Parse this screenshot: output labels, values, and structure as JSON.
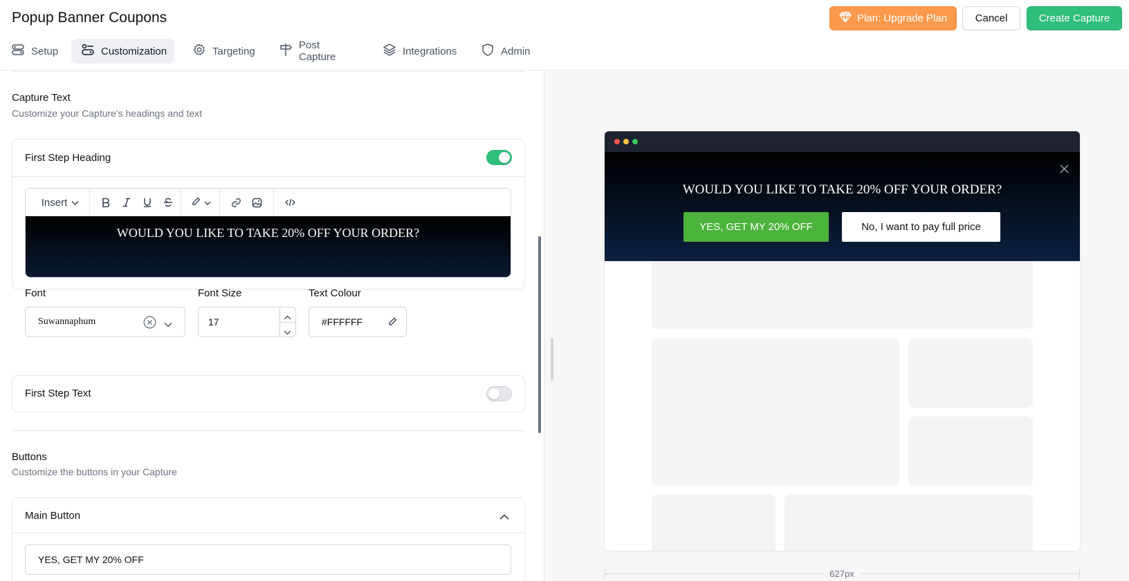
{
  "header": {
    "title": "Popup Banner Coupons",
    "upgrade_label": "Plan: Upgrade Plan",
    "cancel_label": "Cancel",
    "create_label": "Create Capture"
  },
  "tabs": [
    {
      "label": "Setup",
      "icon": "setup-icon"
    },
    {
      "label": "Customization",
      "icon": "customization-icon",
      "active": true
    },
    {
      "label": "Targeting",
      "icon": "gear-icon"
    },
    {
      "label": "Post Capture",
      "icon": "signpost-icon"
    },
    {
      "label": "Integrations",
      "icon": "layers-icon"
    },
    {
      "label": "Admin",
      "icon": "shield-icon"
    }
  ],
  "capture_text": {
    "title": "Capture Text",
    "subtitle": "Customize your Capture's headings and text"
  },
  "first_step_heading": {
    "label": "First Step Heading",
    "enabled": true,
    "editor": {
      "insert_label": "Insert",
      "content": "WOULD YOU LIKE TO TAKE 20% OFF YOUR ORDER?"
    },
    "font_label": "Font",
    "font_value": "Suwannaphum",
    "font_size_label": "Font Size",
    "font_size_value": "17",
    "text_colour_label": "Text Colour",
    "text_colour_value": "#FFFFFF"
  },
  "first_step_text": {
    "label": "First Step Text",
    "enabled": false
  },
  "buttons": {
    "title": "Buttons",
    "subtitle": "Customize the buttons in your Capture",
    "main_button_label": "Main Button",
    "main_button_value": "YES, GET MY 20% OFF"
  },
  "preview": {
    "heading": "WOULD YOU LIKE TO TAKE 20% OFF YOUR ORDER?",
    "yes_button": "YES, GET MY 20% OFF",
    "no_button": "No, I want to pay full price",
    "width_label": "627px"
  },
  "colors": {
    "accent_green": "#2fbe7b",
    "upgrade_orange": "#fb9a4d",
    "preview_yes_green": "#4cb33c"
  }
}
